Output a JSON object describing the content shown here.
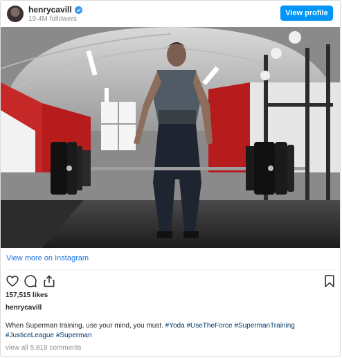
{
  "header": {
    "username": "henrycavill",
    "followers": "19.4M followers",
    "view_profile_label": "View profile"
  },
  "post": {
    "view_more_label": "View more on Instagram",
    "likes": "157,515 likes",
    "author": "henrycavill",
    "caption_text": "When Superman training, use your mind, you must.",
    "hashtags": [
      "#Yoda",
      "#UseTheForce",
      "#SupermanTraining",
      "#JusticeLeague",
      "#Superman"
    ],
    "comments_label": "view all 5,818 comments"
  },
  "icons": [
    "verified-icon",
    "heart-icon",
    "comment-icon",
    "share-icon",
    "bookmark-icon"
  ],
  "colors": {
    "accent": "#0095f6",
    "link": "#1b74e4",
    "hashtag": "#00376b",
    "muted": "#8e8e8e"
  }
}
